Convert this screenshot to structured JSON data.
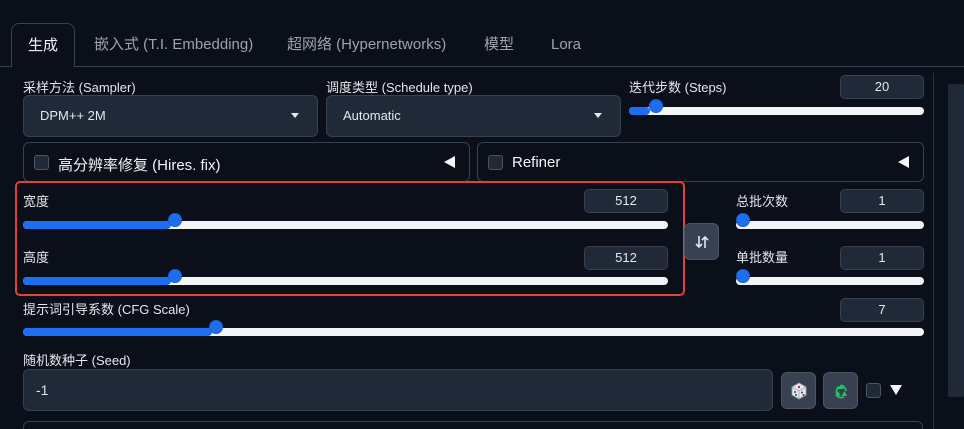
{
  "tabs": [
    {
      "label": "生成",
      "active": true
    },
    {
      "label": "嵌入式 (T.I. Embedding)",
      "active": false
    },
    {
      "label": "超网络 (Hypernetworks)",
      "active": false
    },
    {
      "label": "模型",
      "active": false
    },
    {
      "label": "Lora",
      "active": false
    }
  ],
  "sampler": {
    "label": "采样方法 (Sampler)",
    "value": "DPM++ 2M"
  },
  "schedule": {
    "label": "调度类型 (Schedule type)",
    "value": "Automatic"
  },
  "steps": {
    "label": "迭代步数 (Steps)",
    "value": "20",
    "fraction": 0.07
  },
  "hires": {
    "label": "高分辨率修复 (Hires. fix)",
    "checked": false
  },
  "refiner": {
    "label": "Refiner",
    "checked": false
  },
  "width": {
    "label": "宽度",
    "value": "512",
    "fraction": 0.23
  },
  "height": {
    "label": "高度",
    "value": "512",
    "fraction": 0.23
  },
  "batch_count": {
    "label": "总批次数",
    "value": "1",
    "fraction": 0.0
  },
  "batch_size": {
    "label": "单批数量",
    "value": "1",
    "fraction": 0.0
  },
  "cfg": {
    "label": "提示词引导系数 (CFG Scale)",
    "value": "7",
    "fraction": 0.21
  },
  "seed": {
    "label": "随机数种子 (Seed)",
    "value": "-1"
  },
  "colors": {
    "accent": "#1d6ef0",
    "highlight": "#e0413b",
    "background": "#0b0f19",
    "recycle": "#22c55e"
  },
  "icons": [
    "swap-icon",
    "dice-icon",
    "recycle-icon",
    "caret-down-icon",
    "triangle-left-icon"
  ]
}
